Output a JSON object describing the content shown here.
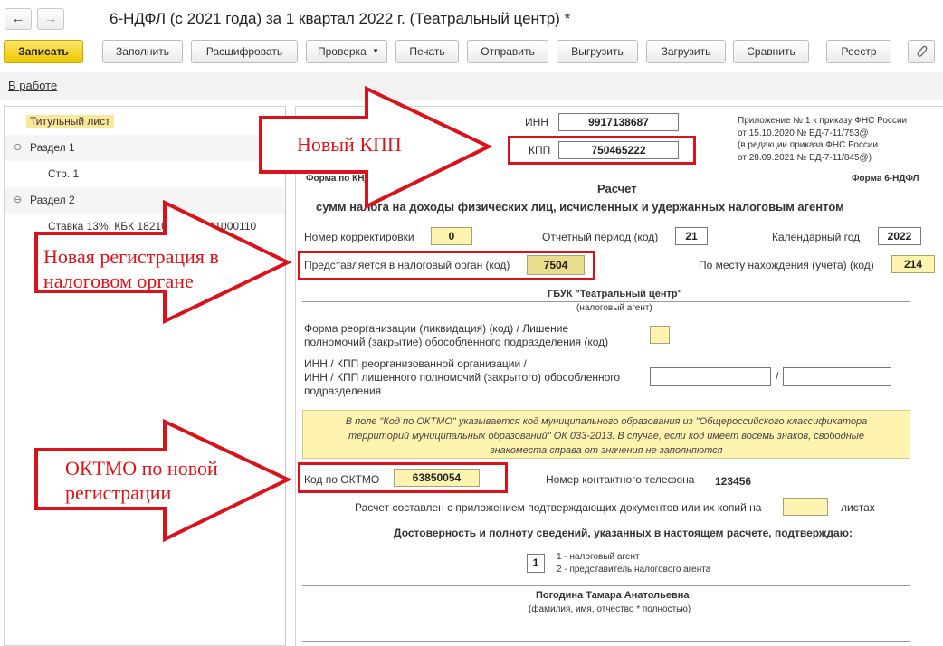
{
  "window": {
    "back_glyph": "←",
    "forward_glyph": "→",
    "title": "6-НДФЛ (с 2021 года) за 1 квартал 2022 г. (Театральный центр) *"
  },
  "toolbar": {
    "save": "Записать",
    "fill": "Заполнить",
    "decode": "Расшифровать",
    "check": "Проверка",
    "print": "Печать",
    "send": "Отправить",
    "export": "Выгрузить",
    "import": "Загрузить",
    "compare": "Сравнить",
    "registry": "Реестр"
  },
  "status": {
    "label": "В работе"
  },
  "tree": {
    "items": [
      {
        "label": "Титульный лист",
        "selected": true
      },
      {
        "label": "Раздел 1",
        "expanded": true
      },
      {
        "label": "Стр. 1"
      },
      {
        "label": "Раздел 2",
        "expanded": true
      },
      {
        "label": "Ставка 13%, КБК 18210102010011000110"
      }
    ]
  },
  "form": {
    "inn_label": "ИНН",
    "inn": "9917138687",
    "kpp_label": "КПП",
    "kpp": "750465222",
    "order_note": [
      "Приложение № 1 к приказу ФНС России",
      "от 15.10.2020 № ЕД-7-11/753@",
      "(в редакции приказа ФНС России",
      "от 28.09.2021 № ЕД-7-11/845@)"
    ],
    "knd": "Форма по КНД 1151100",
    "form_name": "Форма 6-НДФЛ",
    "heading1": "Расчет",
    "heading2": "сумм налога на доходы физических лиц, исчисленных и удержанных налоговым агентом",
    "correction_label": "Номер корректировки",
    "correction": "0",
    "period_label": "Отчетный период (код)",
    "period": "21",
    "year_label": "Календарный год",
    "year": "2022",
    "tax_authority_label": "Представляется в налоговый орган (код)",
    "tax_authority": "7504",
    "location_label": "По месту нахождения (учета) (код)",
    "location": "214",
    "agent_name": "ГБУК \"Театральный центр\"",
    "agent_caption": "(налоговый агент)",
    "reorg_label": [
      "Форма реорганизации (ликвидация) (код) / Лишение",
      "полномочий (закрытие) обособленного подразделения (код)"
    ],
    "reorg_inn_label": [
      "ИНН / КПП реорганизованной организации /",
      "ИНН / КПП лишенного полномочий (закрытого) обособленного",
      "подразделения"
    ],
    "slash": "/",
    "notice": [
      "В поле \"Код по ОКТМО\" указывается код муниципального образования из \"Общероссийского классификатора",
      "территорий муниципальных образований\" ОК 033-2013. В случае, если код имеет восемь знаков, свободные",
      "знакоместа справа от значения не заполняются"
    ],
    "oktmo_label": "Код по ОКТМО",
    "oktmo": "63850054",
    "phone_label": "Номер контактного телефона",
    "phone": "123456",
    "docs_label": "Расчет составлен с приложением подтверждающих документов или их копий на",
    "docs_suffix": "листах",
    "confirm": "Достоверность и полноту сведений, указанных в настоящем расчете, подтверждаю:",
    "signer_code": "1",
    "signer_opt1": "1 - налоговый агент",
    "signer_opt2": "2 - представитель налогового агента",
    "signer_name": "Погодина Тамара Анатольевна",
    "signer_caption": "(фамилия, имя, отчество * полностью)"
  },
  "annotations": {
    "new_kpp": "Новый КПП",
    "new_registration": [
      "Новая регистрация в",
      "налоговом органе"
    ],
    "oktmo_new": [
      "ОКТМО по новой",
      "регистрации"
    ]
  },
  "colors": {
    "annotation_red": "#d8131b",
    "highlight_yellow": "#fff3b0",
    "save_button": "#f5d223"
  }
}
